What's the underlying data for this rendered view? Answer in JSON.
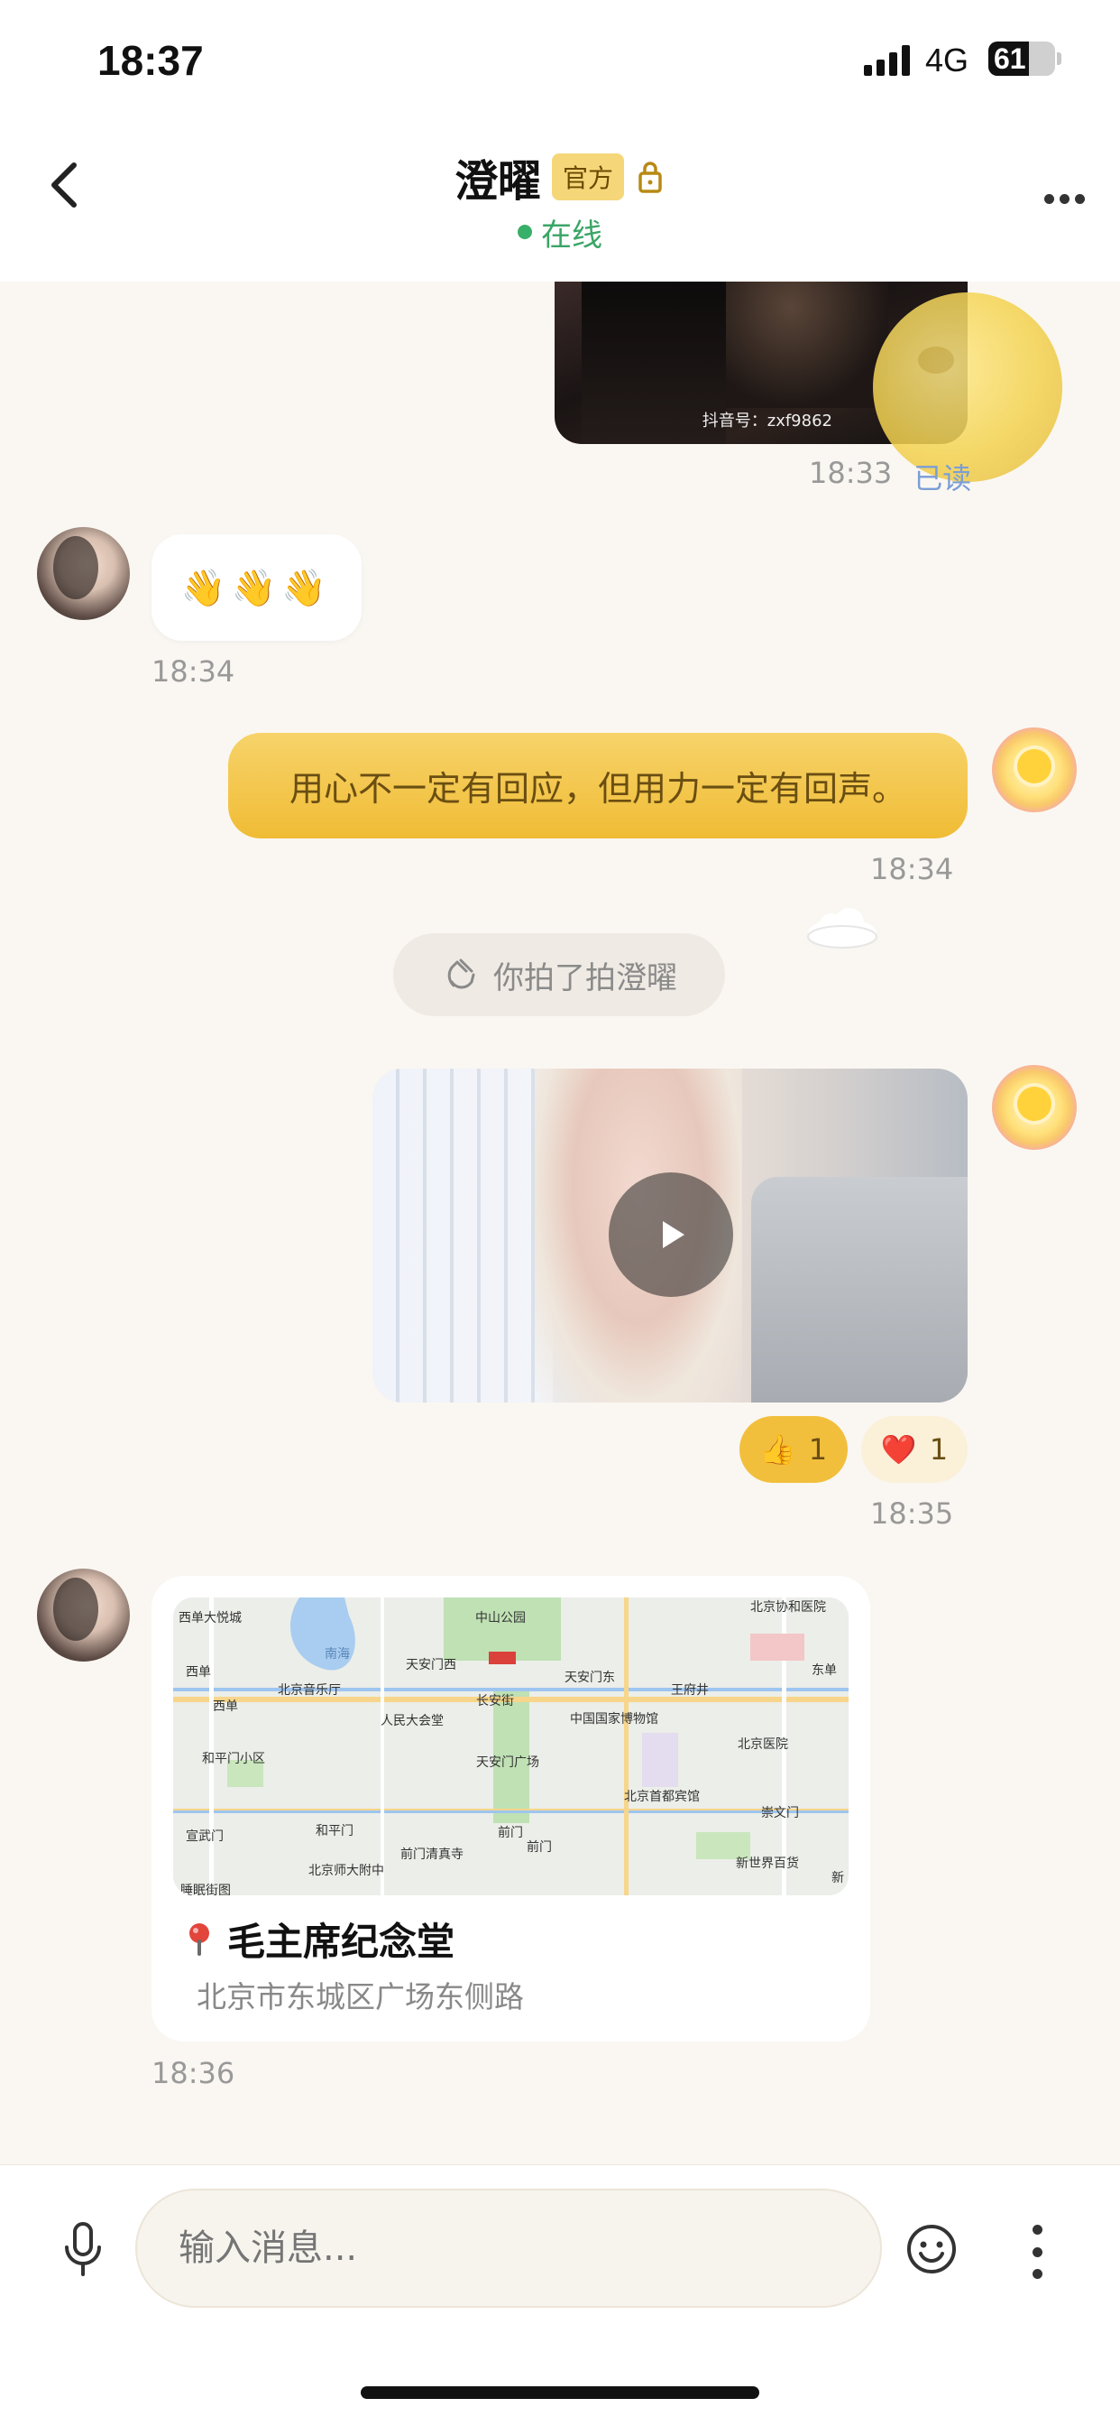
{
  "status_bar": {
    "time": "18:37",
    "network": "4G",
    "battery": "61",
    "battery_level": 0.61
  },
  "header": {
    "title": "澄曜",
    "badge": "官方",
    "status": "在线"
  },
  "icons": {
    "back": "chevron-left-icon",
    "lock": "lock-icon",
    "more": "more-horizontal-icon",
    "play": "play-icon",
    "pin": "map-pin-icon",
    "mic": "microphone-icon",
    "emoji": "smiley-icon",
    "menu": "more-vertical-icon",
    "pat": "clap-hand-icon",
    "cloud": "cloud-icon",
    "moon": "moon-sticker",
    "tiktok": "tiktok-icon"
  },
  "colors": {
    "accent": "#f0bc35",
    "online": "#39b069",
    "read": "#7a9ed6",
    "background": "#faf7f2"
  },
  "messages": {
    "image_top": {
      "watermark": "抖音号：zxf9862",
      "time": "18:33",
      "read_status": "已读"
    },
    "wave": {
      "content": "👋👋👋",
      "time": "18:34"
    },
    "quote": {
      "text": "用心不一定有回应，但用力一定有回声。",
      "time": "18:34"
    },
    "pat": {
      "text": "你拍了拍澄曜"
    },
    "video": {
      "time": "18:35",
      "reactions": [
        {
          "emoji": "👍",
          "count": "1"
        },
        {
          "emoji": "❤️",
          "count": "1"
        }
      ]
    },
    "location": {
      "title": "毛主席纪念堂",
      "address": "北京市东城区广场东侧路",
      "time": "18:36",
      "map_labels": [
        "西单大悦城",
        "南海",
        "中山公园",
        "北京协和医院",
        "西单",
        "天安门西",
        "天安门东",
        "东单",
        "西单",
        "北京音乐厅",
        "长安街",
        "王府井",
        "人民大会堂",
        "中国国家博物馆",
        "和平门小区",
        "天安门广场",
        "北京医院",
        "北京首都宾馆",
        "宣武门",
        "和平门",
        "前门",
        "崇文门",
        "北京师大附中",
        "前门清真寺",
        "新世界百货",
        "前门",
        "新",
        "睡眠街图"
      ]
    }
  },
  "input": {
    "placeholder": "输入消息..."
  }
}
